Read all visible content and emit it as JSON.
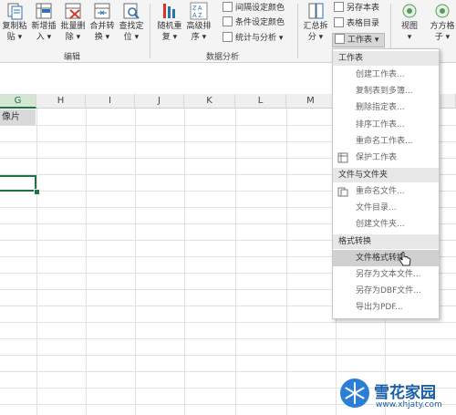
{
  "ribbon": {
    "buttons": [
      {
        "line1": "复制粘",
        "line2": "贴 ▾"
      },
      {
        "line1": "新增插",
        "line2": "入 ▾"
      },
      {
        "line1": "批量删",
        "line2": "除 ▾"
      },
      {
        "line1": "合并转",
        "line2": "换 ▾"
      },
      {
        "line1": "查找定",
        "line2": "位 ▾"
      },
      {
        "line1": "随机重",
        "line2": "复 ▾"
      },
      {
        "line1": "高级排",
        "line2": "序 ▾"
      },
      {
        "line1": "汇总拆",
        "line2": "分 ▾"
      },
      {
        "line1": "视图",
        "line2": "▾"
      },
      {
        "line1": "方方格",
        "line2": "子 ▾"
      }
    ],
    "small_items": {
      "interval_color": "间隔设定颜色",
      "conditional_color": "条件设定颜色",
      "stats_analysis": "统计与分析 ▾",
      "save_sheet": "另存本表",
      "sheet_directory": "表格目录",
      "worksheet": "工作表 ▾"
    },
    "groups": {
      "edit": "编辑",
      "data_analysis": "数据分析"
    }
  },
  "grid": {
    "columns": [
      "G",
      "H",
      "I",
      "J",
      "K",
      "L",
      "M"
    ],
    "selected_column": "G",
    "cell_g1": "像片"
  },
  "dropdown_menu": {
    "section_worksheet": "工作表",
    "items_worksheet": [
      "创建工作表...",
      "复制表到多簿...",
      "删除指定表...",
      "排序工作表...",
      "重命名工作表...",
      "保护工作表"
    ],
    "section_files": "文件与文件夹",
    "items_files": [
      "重命名文件...",
      "文件目录...",
      "创建文件夹..."
    ],
    "section_format": "格式转换",
    "items_format": [
      "文件格式转换",
      "另存为文本文件...",
      "另存为DBF文件...",
      "导出为PDF..."
    ]
  },
  "watermark": {
    "brand": "雪花家园",
    "url": "www.xhjaty.com"
  },
  "colors": {
    "accent": "#217346",
    "highlight": "#d0d0d0",
    "section_bg": "#e7e7e7"
  }
}
